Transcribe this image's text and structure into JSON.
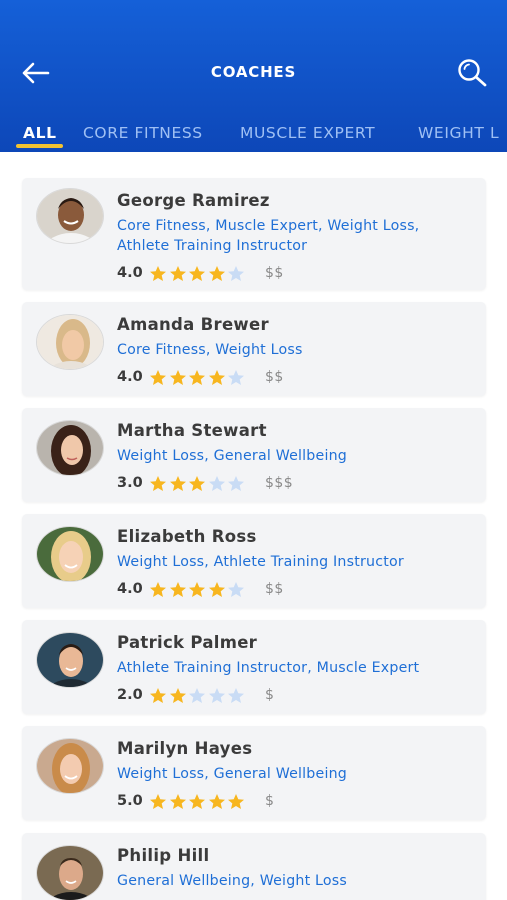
{
  "header": {
    "title": "COACHES",
    "back_icon": "back-arrow-icon",
    "search_icon": "search-icon",
    "colors": {
      "bar": "#0d4fc2",
      "accent": "#f2c230"
    }
  },
  "tabs": [
    {
      "label": "ALL",
      "active": true
    },
    {
      "label": "CORE FITNESS",
      "active": false
    },
    {
      "label": "MUSCLE EXPERT",
      "active": false
    },
    {
      "label": "WEIGHT L",
      "active": false
    }
  ],
  "coaches": [
    {
      "name": "George Ramirez",
      "specialties": "Core Fitness, Muscle Expert, Weight Loss, Athlete Training Instructor",
      "rating": "4.0",
      "stars": 4,
      "price": "$$"
    },
    {
      "name": "Amanda Brewer",
      "specialties": "Core Fitness, Weight Loss",
      "rating": "4.0",
      "stars": 4,
      "price": "$$"
    },
    {
      "name": "Martha Stewart",
      "specialties": "Weight Loss, General Wellbeing",
      "rating": "3.0",
      "stars": 3,
      "price": "$$$"
    },
    {
      "name": "Elizabeth Ross",
      "specialties": "Weight Loss, Athlete Training Instructor",
      "rating": "4.0",
      "stars": 4,
      "price": "$$"
    },
    {
      "name": "Patrick Palmer",
      "specialties": "Athlete Training Instructor, Muscle Expert",
      "rating": "2.0",
      "stars": 2,
      "price": "$"
    },
    {
      "name": "Marilyn Hayes",
      "specialties": "Weight Loss, General Wellbeing",
      "rating": "5.0",
      "stars": 5,
      "price": "$"
    },
    {
      "name": "Philip Hill",
      "specialties": "General Wellbeing, Weight Loss",
      "rating": "",
      "stars": 0,
      "price": ""
    }
  ],
  "star_colors": {
    "filled": "#f7b61f",
    "empty": "#c9dcf5"
  }
}
